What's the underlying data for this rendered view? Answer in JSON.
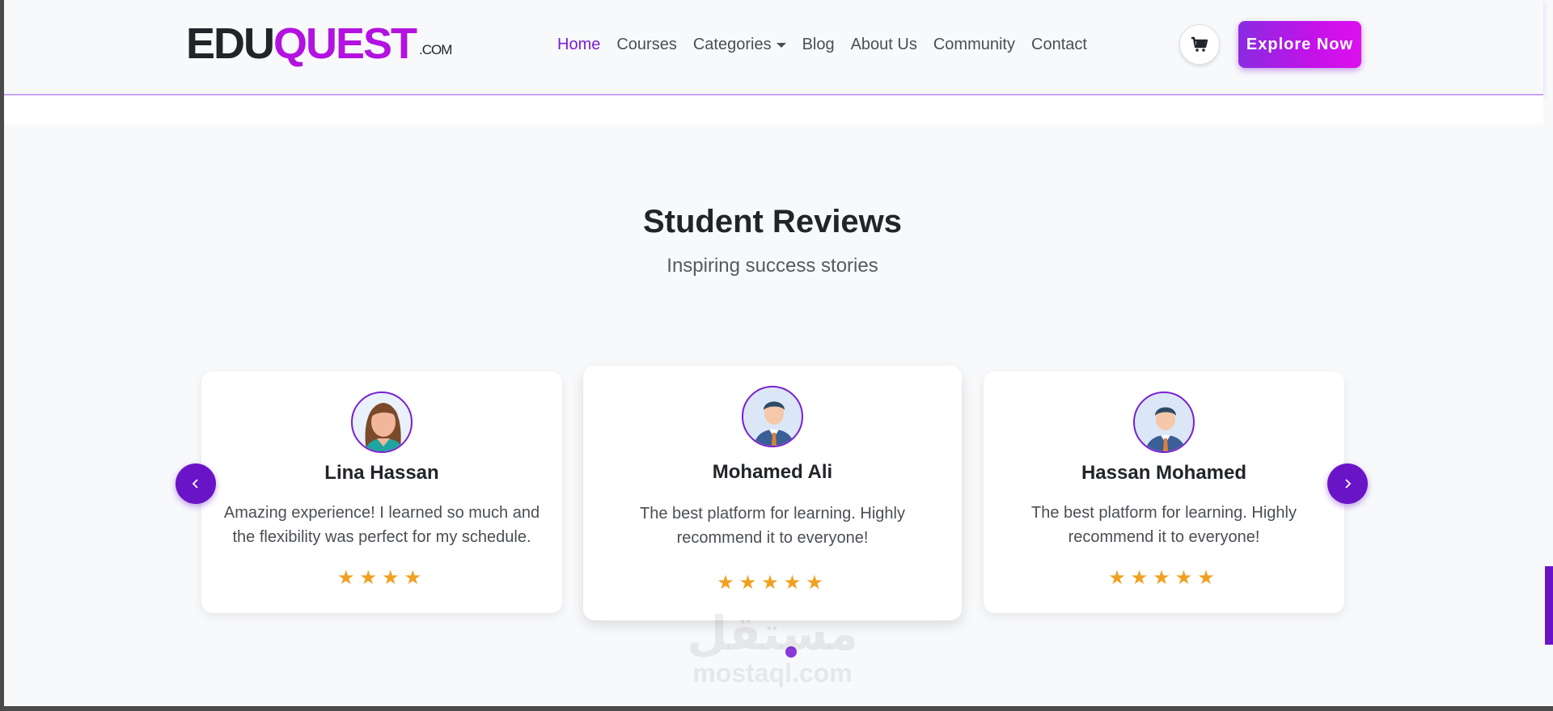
{
  "brand": {
    "edu": "EDU",
    "quest": "QUEST",
    "com": ".COM"
  },
  "nav": {
    "links": [
      "Home",
      "Courses",
      "Categories",
      "Blog",
      "About Us",
      "Community",
      "Contact"
    ],
    "active": "Home",
    "cart_icon": "cart-icon",
    "cta_label": "Explore Now"
  },
  "reviews": {
    "title": "Student Reviews",
    "subtitle": "Inspiring success stories",
    "cards": [
      {
        "name": "Lina Hassan",
        "text": "Amazing experience! I learned so much and the flexibility was perfect for my schedule.",
        "stars": "★★★★",
        "rating": 4
      },
      {
        "name": "Mohamed Ali",
        "text": "The best platform for learning. Highly recommend it to everyone!",
        "stars": "★★★★★",
        "rating": 5
      },
      {
        "name": "Hassan Mohamed",
        "text": "The best platform for learning. Highly recommend it to everyone!",
        "stars": "★★★★★",
        "rating": 5
      }
    ],
    "prev_icon": "chevron-left-icon",
    "next_icon": "chevron-right-icon"
  },
  "watermark": {
    "arabic": "مستقل",
    "latin": "mostaql.com"
  },
  "colors": {
    "accent": "#7a1fd1",
    "quest": "#b312e0",
    "star": "#f0a020",
    "arrow": "#6a14c8"
  }
}
